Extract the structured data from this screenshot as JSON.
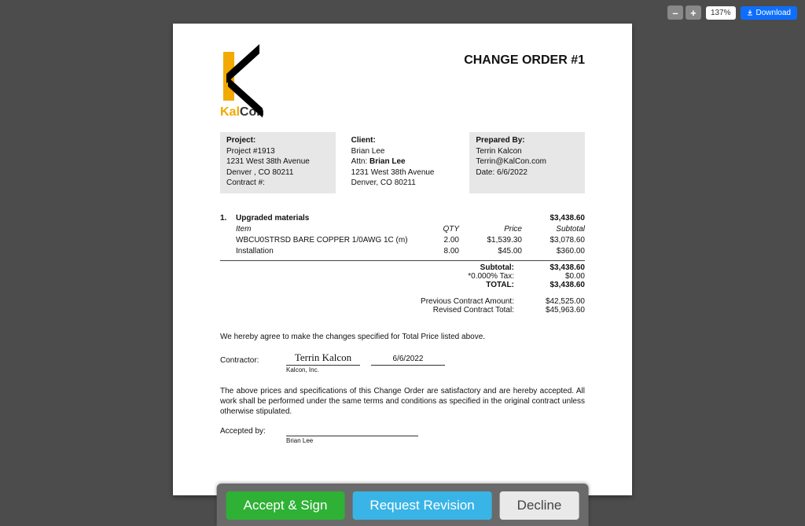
{
  "toolbar": {
    "zoom_minus": "–",
    "zoom_plus": "+",
    "zoom_level": "137%",
    "download_label": "Download"
  },
  "company": {
    "name_part1": "Kal",
    "name_part2": "Con"
  },
  "document": {
    "title": "CHANGE ORDER #1"
  },
  "project": {
    "heading": "Project:",
    "name": "Project #1913",
    "address1": "1231 West 38th Avenue",
    "address2": "Denver , CO 80211",
    "contract_label": "Contract #:"
  },
  "client": {
    "heading": "Client:",
    "name": "Brian Lee",
    "attn_label": "Attn: ",
    "attn_name": "Brian Lee",
    "address1": "1231 West 38th Avenue",
    "address2": "Denver, CO 80211"
  },
  "prepared": {
    "heading": "Prepared By:",
    "name": "Terrin Kalcon",
    "email": "Terrin@KalCon.com",
    "date_label": "Date: ",
    "date": "6/6/2022"
  },
  "items": {
    "number": "1.",
    "title": "Upgraded materials",
    "group_total": "$3,438.60",
    "headers": {
      "item": "Item",
      "qty": "QTY",
      "price": "Price",
      "subtotal": "Subtotal"
    },
    "lines": [
      {
        "item": "WBCU0STRSD BARE COPPER 1/0AWG 1C (m)",
        "qty": "2.00",
        "price": "$1,539.30",
        "subtotal": "$3,078.60"
      },
      {
        "item": "Installation",
        "qty": "8.00",
        "price": "$45.00",
        "subtotal": "$360.00"
      }
    ]
  },
  "totals": {
    "subtotal_label": "Subtotal:",
    "subtotal": "$3,438.60",
    "tax_label": "*0.000% Tax:",
    "tax": "$0.00",
    "total_label": "TOTAL:",
    "total": "$3,438.60",
    "prev_label": "Previous Contract Amount:",
    "prev": "$42,525.00",
    "revised_label": "Revised Contract Total:",
    "revised": "$45,963.60"
  },
  "agreement": {
    "line1": "We hereby agree to make the changes specified for Total Price listed above.",
    "contractor_label": "Contractor:",
    "contractor_signature": "Terrin Kalcon",
    "contractor_date": "6/6/2022",
    "contractor_company": "Kalcon, Inc.",
    "terms": "The above prices and specifications of this Change Order are satisfactory and are hereby accepted. All work shall be performed under the same terms and conditions as specified in the original contract unless otherwise stipulated.",
    "accepted_label": "Accepted by:",
    "accepted_name": "Brian Lee"
  },
  "actions": {
    "accept": "Accept & Sign",
    "revise": "Request Revision",
    "decline": "Decline"
  }
}
